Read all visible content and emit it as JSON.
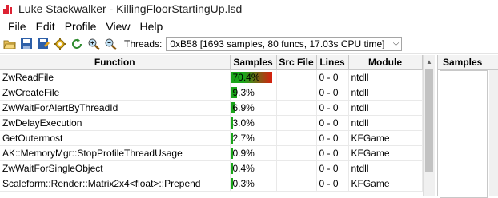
{
  "window": {
    "title": "Luke Stackwalker - KillingFloorStartingUp.lsd"
  },
  "menu": [
    "File",
    "Edit",
    "Profile",
    "View",
    "Help"
  ],
  "toolbar": {
    "icons": [
      "open-file-icon",
      "save-icon",
      "save-as-icon",
      "settings-icon",
      "refresh-icon",
      "zoom-in-icon",
      "zoom-out-icon"
    ],
    "threads_label": "Threads:",
    "threads_value": "0xB58 [1693 samples, 80 funcs, 17.03s CPU time]"
  },
  "table": {
    "columns": [
      "Function",
      "Samples",
      "Src File",
      "Lines",
      "Module"
    ],
    "rows": [
      {
        "function": "ZwReadFile",
        "samples": "70.4%",
        "pct": 70.4,
        "src": "",
        "lines": "0 - 0",
        "module": "ntdll"
      },
      {
        "function": "ZwCreateFile",
        "samples": "9.3%",
        "pct": 9.3,
        "src": "",
        "lines": "0 - 0",
        "module": "ntdll"
      },
      {
        "function": "ZwWaitForAlertByThreadId",
        "samples": "6.9%",
        "pct": 6.9,
        "src": "",
        "lines": "0 - 0",
        "module": "ntdll"
      },
      {
        "function": "ZwDelayExecution",
        "samples": "3.0%",
        "pct": 3.0,
        "src": "",
        "lines": "0 - 0",
        "module": "ntdll"
      },
      {
        "function": "GetOutermost",
        "samples": "2.7%",
        "pct": 2.7,
        "src": "",
        "lines": "0 - 0",
        "module": "KFGame"
      },
      {
        "function": "AK::MemoryMgr::StopProfileThreadUsage",
        "samples": "0.9%",
        "pct": 0.9,
        "src": "",
        "lines": "0 - 0",
        "module": "KFGame"
      },
      {
        "function": "ZwWaitForSingleObject",
        "samples": "0.4%",
        "pct": 0.4,
        "src": "",
        "lines": "0 - 0",
        "module": "ntdll"
      },
      {
        "function": "Scaleform::Render::Matrix2x4<float>::Prepend",
        "samples": "0.3%",
        "pct": 0.3,
        "src": "",
        "lines": "0 - 0",
        "module": "KFGame"
      }
    ]
  },
  "right_panel": {
    "header": "Samples"
  },
  "colors": {
    "bar_high": "#d81e0e",
    "bar_low": "#1aa51a"
  }
}
